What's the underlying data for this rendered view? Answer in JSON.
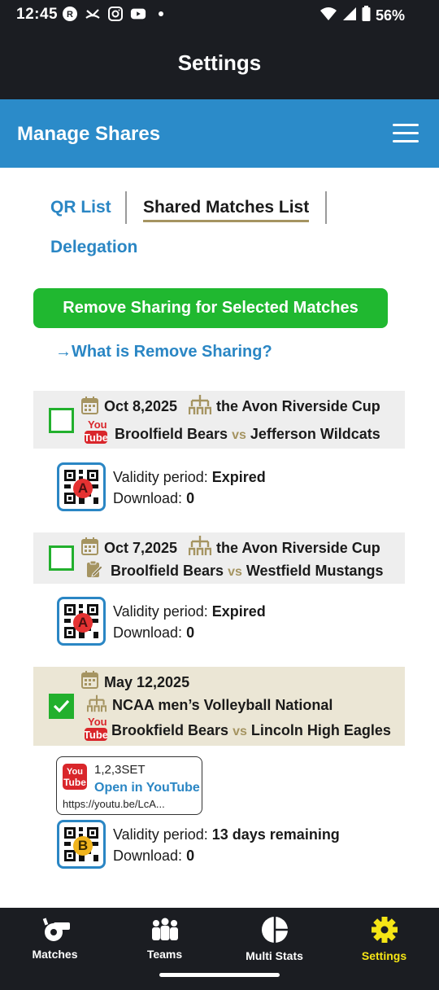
{
  "status_bar": {
    "time": "12:45",
    "battery": "56%"
  },
  "header": {
    "title": "Settings"
  },
  "subheader": {
    "title": "Manage Shares"
  },
  "tabs": [
    {
      "label": "QR List"
    },
    {
      "label": "Shared Matches List"
    },
    {
      "label": "Delegation"
    }
  ],
  "actions": {
    "remove_button": "Remove Sharing for Selected Matches",
    "what_is_link": "→What is Remove Sharing?"
  },
  "matches": [
    {
      "date": "Oct 8,2025",
      "tournament": "the Avon Riverside Cup",
      "team_home": "Broolfield Bears",
      "vs": "vs",
      "team_away": "Jefferson Wildcats",
      "source": "youtube",
      "checked": false,
      "qr_badge": "A",
      "validity_label": "Validity period: ",
      "validity_value": "Expired",
      "download_label": "Download: ",
      "download_value": "0"
    },
    {
      "date": "Oct 7,2025",
      "tournament": "the Avon Riverside Cup",
      "team_home": "Broolfield Bears",
      "vs": "vs",
      "team_away": "Westfield Mustangs",
      "source": "clipboard",
      "checked": false,
      "qr_badge": "A",
      "validity_label": "Validity period: ",
      "validity_value": "Expired",
      "download_label": "Download: ",
      "download_value": "0"
    },
    {
      "date": "May 12,2025",
      "tournament": "NCAA men’s Volleyball National",
      "team_home": "Brookfield Bears",
      "vs": "vs",
      "team_away": "Lincoln High Eagles",
      "source": "youtube",
      "checked": true,
      "youtube_card": {
        "sets": "1,2,3SET",
        "open_label": "Open in YouTube",
        "url": "https://youtu.be/LcA..."
      },
      "qr_badge": "B",
      "validity_label": "Validity period: ",
      "validity_value": "13 days remaining",
      "download_label": "Download: ",
      "download_value": "0"
    }
  ],
  "youtube_logo_text": {
    "top": "You",
    "bottom": "Tube"
  },
  "bottom_nav": [
    {
      "label": "Matches",
      "icon": "whistle-icon"
    },
    {
      "label": "Teams",
      "icon": "team-icon"
    },
    {
      "label": "Multi Stats",
      "icon": "pie-chart-icon"
    },
    {
      "label": "Settings",
      "icon": "gear-icon",
      "active": true
    }
  ],
  "colors": {
    "accent_blue": "#2a86c4",
    "green": "#20b830",
    "gold": "#a59461",
    "nav_active": "#f5e515",
    "dark_bar": "#1b1d22"
  }
}
